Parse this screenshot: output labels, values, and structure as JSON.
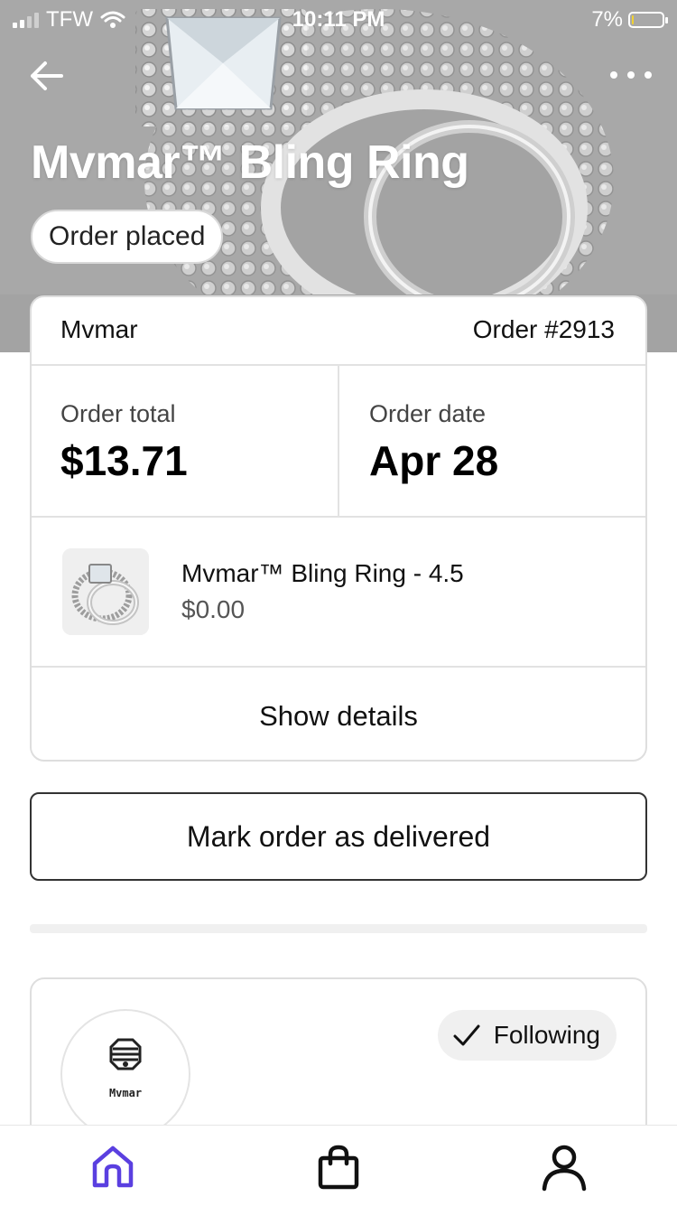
{
  "status_bar": {
    "carrier": "TFW",
    "time": "10:11 PM",
    "battery": "7%",
    "battery_level": 0.07,
    "icons": [
      "signal-icon",
      "wifi-icon",
      "battery-icon"
    ]
  },
  "header": {
    "back_icon": "arrow-left-icon",
    "more_icon": "more-horizontal-icon",
    "title": "Mvmar™ Bling Ring",
    "status": "Order placed"
  },
  "order": {
    "shop_name": "Mvmar",
    "order_number": "Order #2913",
    "total_label": "Order total",
    "total_value": "$13.71",
    "date_label": "Order date",
    "date_value": "Apr 28",
    "item": {
      "name": "Mvmar™ Bling Ring - 4.5",
      "price": "$0.00"
    },
    "show_details": "Show details"
  },
  "actions": {
    "mark_delivered": "Mark order as delivered"
  },
  "shop": {
    "logo_text": "Mvmar",
    "follow_label": "Following",
    "follow_icon": "check-icon"
  },
  "tabbar": {
    "items": [
      "home-icon",
      "shopping-bag-icon",
      "profile-icon"
    ],
    "active": "home",
    "active_color": "#5a3fe0"
  },
  "colors": {
    "hero_bg": "#a9a9a9",
    "battery_level": "#f2d230"
  }
}
